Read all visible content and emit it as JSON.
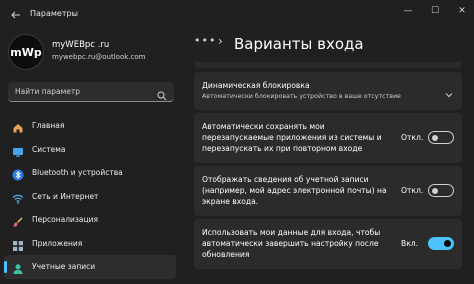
{
  "app": {
    "title": "Параметры"
  },
  "window_controls": {
    "minimize": "—",
    "maximize": "☐",
    "close": "✕"
  },
  "profile": {
    "avatar_text": "mWp",
    "name": "myWEBpc .ru",
    "email": "mywebpc.ru@outlook.com"
  },
  "search": {
    "placeholder": "Найти параметр"
  },
  "sidebar": {
    "items": [
      {
        "label": "Главная",
        "icon": "home-icon"
      },
      {
        "label": "Система",
        "icon": "monitor-icon"
      },
      {
        "label": "Bluetooth и устройства",
        "icon": "bluetooth-icon"
      },
      {
        "label": "Сеть и Интернет",
        "icon": "wifi-icon"
      },
      {
        "label": "Персонализация",
        "icon": "brush-icon"
      },
      {
        "label": "Приложения",
        "icon": "apps-icon"
      },
      {
        "label": "Учетные записи",
        "icon": "account-icon",
        "active": true
      }
    ]
  },
  "header": {
    "overflow": "•••",
    "separator": "›",
    "title": "Варианты входа"
  },
  "settings": {
    "dynamic_lock": {
      "title": "Динамическая блокировка",
      "subtitle": "Автоматически блокировать устройство в ваше отсутствие"
    },
    "restart_apps": {
      "text": "Автоматически сохранять мои перезапускаемые приложения из системы и перезапускать их при повторном входе",
      "state_label": "Откл.",
      "enabled": false
    },
    "show_account_details": {
      "text": "Отображать сведения об учетной записи (например, мой адрес электронной почты) на экране входа.",
      "state_label": "Откл.",
      "enabled": false
    },
    "use_signin_info": {
      "text": "Использовать мои данные для входа, чтобы автоматически завершить настройку после обновления",
      "state_label": "Вкл.",
      "enabled": true
    }
  },
  "colors": {
    "accent": "#4cc2ff",
    "background": "#202020",
    "card": "#2b2b2b"
  }
}
